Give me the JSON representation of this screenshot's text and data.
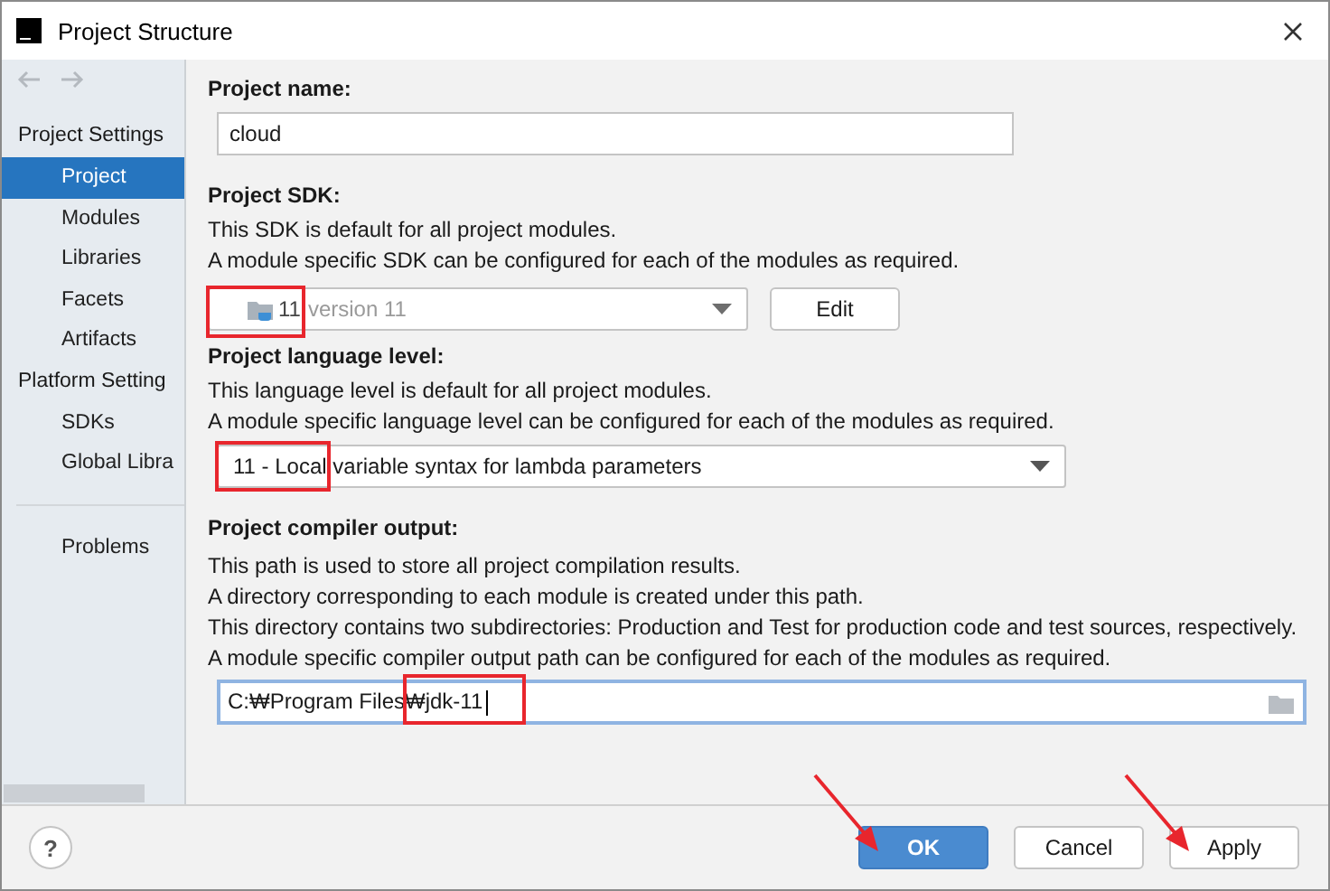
{
  "window": {
    "title": "Project Structure"
  },
  "sidebar": {
    "sections": [
      {
        "header": "Project Settings",
        "items": [
          {
            "label": "Project",
            "selected": true
          },
          {
            "label": "Modules",
            "selected": false
          },
          {
            "label": "Libraries",
            "selected": false
          },
          {
            "label": "Facets",
            "selected": false
          },
          {
            "label": "Artifacts",
            "selected": false
          }
        ]
      },
      {
        "header": "Platform Setting",
        "items": [
          {
            "label": "SDKs",
            "selected": false
          },
          {
            "label": "Global Libra",
            "selected": false
          }
        ]
      }
    ],
    "bottom_items": [
      {
        "label": "Problems",
        "selected": false
      }
    ]
  },
  "project_name": {
    "label": "Project name:",
    "value": "cloud"
  },
  "project_sdk": {
    "label": "Project SDK:",
    "lines": [
      "This SDK is default for all project modules.",
      "A module specific SDK can be configured for each of the modules as required."
    ],
    "sdk_name": "11",
    "sdk_version": "version 11",
    "annotated": true,
    "edit_button": "Edit"
  },
  "language_level": {
    "label": "Project language level:",
    "lines": [
      "This language level is default for all project modules.",
      "A module specific language level can be configured for each of the modules as required."
    ],
    "value": "11 - Local variable syntax for lambda parameters",
    "annotated": true
  },
  "compiler_output": {
    "label": "Project compiler output:",
    "lines": [
      "This path is used to store all project compilation results.",
      "A directory corresponding to each module is created under this path.",
      "This directory contains two subdirectories: Production and Test for production code and test sources, respectively.",
      "A module specific compiler output path can be configured for each of the modules as required."
    ],
    "value": "C:₩Program Files₩jdk-11",
    "focused": true,
    "annotated": true
  },
  "buttons": [
    {
      "kind": "help",
      "label": "?",
      "pointed": false
    },
    {
      "kind": "primary",
      "label": "OK",
      "pointed": true
    },
    {
      "kind": "default",
      "label": "Cancel",
      "pointed": false
    },
    {
      "kind": "default",
      "label": "Apply",
      "pointed": true
    }
  ]
}
